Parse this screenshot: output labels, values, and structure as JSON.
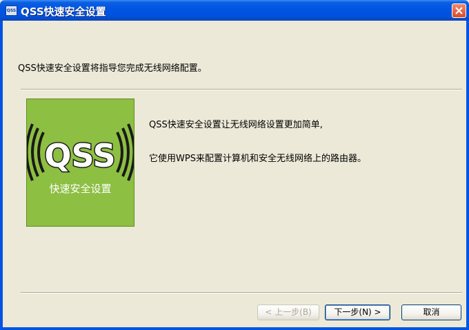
{
  "window": {
    "title": "QSS快速安全设置",
    "icon_text": "QSS",
    "icon": "app-icon",
    "close_icon": "close-icon"
  },
  "main": {
    "intro": "QSS快速安全设置将指导您完成无线网络配置。",
    "logo": {
      "text": "QSS",
      "caption": "快速安全设置",
      "background": "#8dbf42"
    },
    "description_lines": [
      "QSS快速安全设置让无线网络设置更加简单,",
      "它使用WPS来配置计算机和安全无线网络上的路由器。"
    ]
  },
  "buttons": {
    "back": "< 上一步(B)",
    "next": "下一步(N) >",
    "cancel": "取消"
  },
  "colors": {
    "titlebar": "#0054e3",
    "dialog_bg": "#ece9d8",
    "close_button": "#d94a2a"
  }
}
